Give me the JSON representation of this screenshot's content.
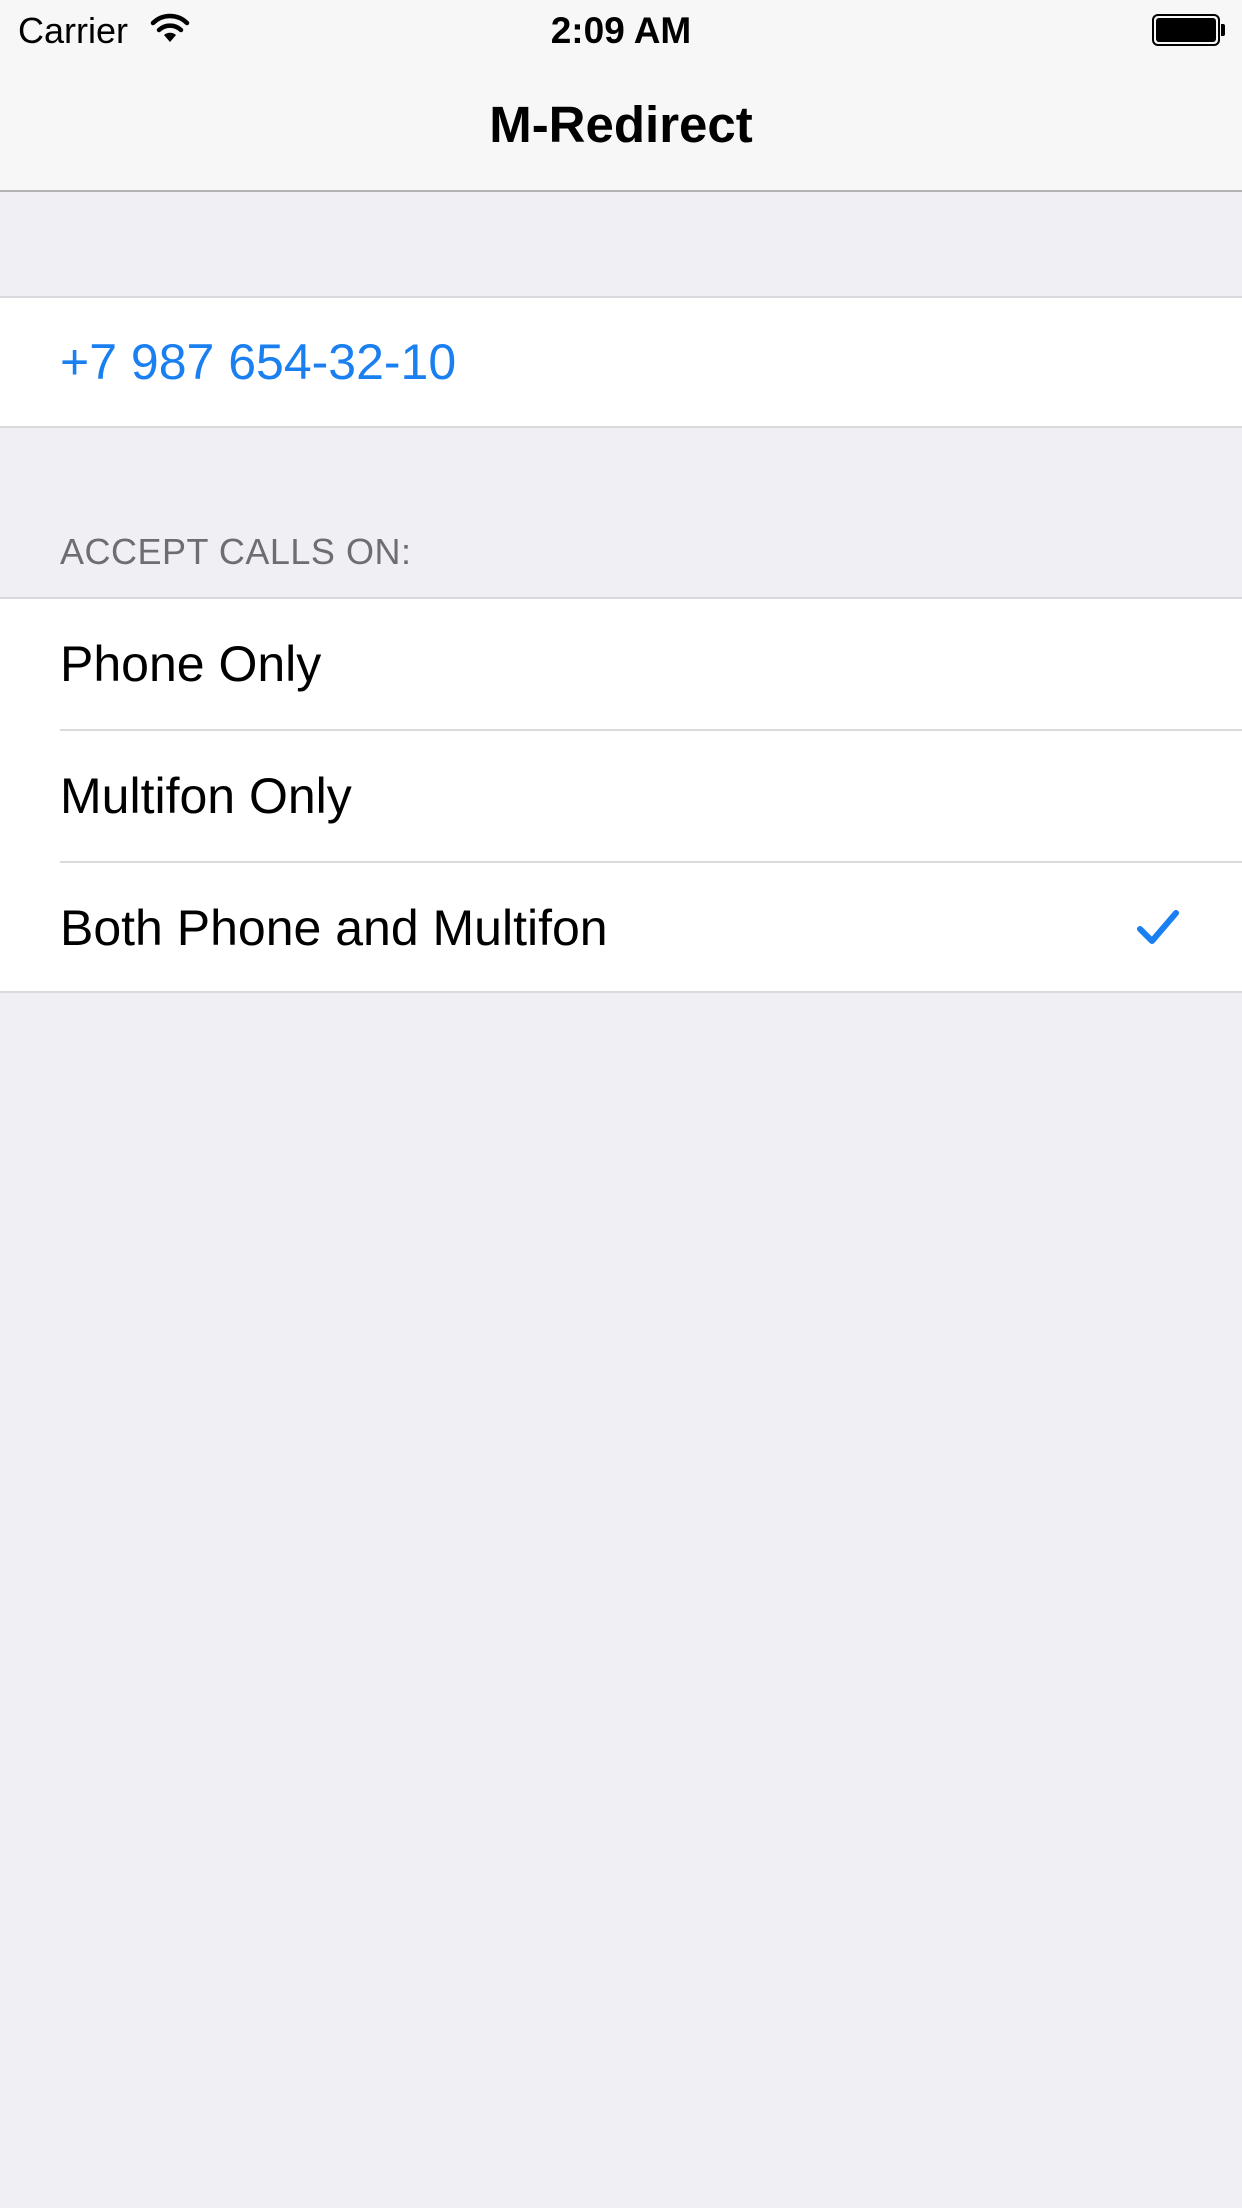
{
  "status_bar": {
    "carrier": "Carrier",
    "time": "2:09 AM"
  },
  "nav": {
    "title": "M-Redirect"
  },
  "phone": {
    "number": "+7 987 654-32-10"
  },
  "accept_calls": {
    "header": "ACCEPT CALLS ON:",
    "options": [
      {
        "label": "Phone Only",
        "selected": false
      },
      {
        "label": "Multifon Only",
        "selected": false
      },
      {
        "label": "Both Phone and Multifon",
        "selected": true
      }
    ]
  },
  "colors": {
    "accent": "#1a7ff0",
    "background": "#efeff4",
    "section_header": "#6d6d72"
  },
  "icons": {
    "wifi": "wifi-icon",
    "battery": "battery-icon",
    "checkmark": "checkmark-icon"
  }
}
